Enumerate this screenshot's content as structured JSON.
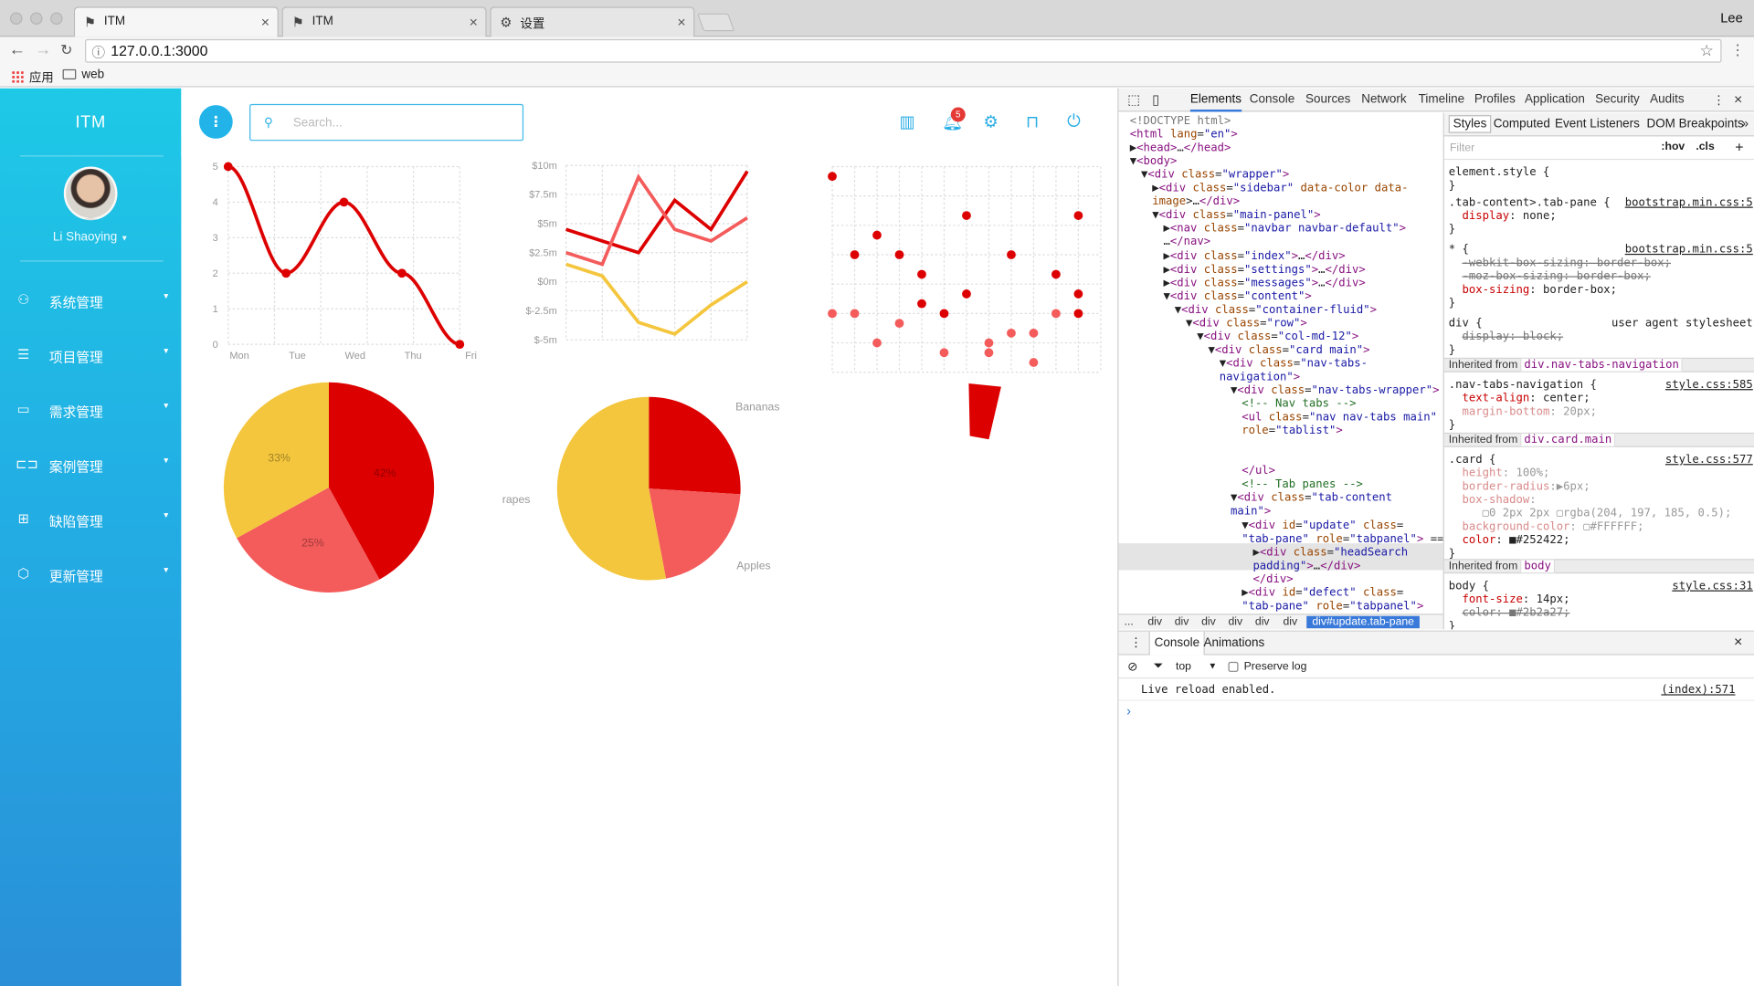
{
  "browser": {
    "tabs": [
      {
        "title": "ITM",
        "icon": "app-favicon"
      },
      {
        "title": "ITM",
        "icon": "app-favicon"
      },
      {
        "title": "设置",
        "icon": "gear-icon"
      }
    ],
    "user": "Lee",
    "url": "127.0.0.1:3000",
    "bookmarks": [
      {
        "label": "应用",
        "icon": "apps-icon"
      },
      {
        "label": "web",
        "icon": "folder-icon"
      }
    ]
  },
  "app": {
    "brand": "ITM",
    "user_name": "Li Shaoying",
    "search_placeholder": "Search...",
    "notification_count": "5",
    "menu": [
      {
        "label": "系统管理",
        "icon": "user-icon"
      },
      {
        "label": "项目管理",
        "icon": "database-icon"
      },
      {
        "label": "需求管理",
        "icon": "message-icon"
      },
      {
        "label": "案例管理",
        "icon": "book-icon"
      },
      {
        "label": "缺陷管理",
        "icon": "bug-icon"
      },
      {
        "label": "更新管理",
        "icon": "box-icon"
      }
    ],
    "header_icons": [
      "chart-icon",
      "bell-icon",
      "settings-icon",
      "lock-icon",
      "power-icon"
    ],
    "colors": {
      "primary": "#23b6e9",
      "red": "#dd0000",
      "light_red": "#f45b5b",
      "yellow": "#f4c63d"
    }
  },
  "chart_data": [
    {
      "type": "line",
      "categories": [
        "Mon",
        "Tue",
        "Wed",
        "Thu",
        "Fri"
      ],
      "series": [
        {
          "values": [
            5,
            2,
            4,
            2,
            0
          ]
        }
      ],
      "ylim": [
        0,
        5
      ],
      "yticks": [
        "0",
        "1",
        "2",
        "3",
        "4",
        "5"
      ]
    },
    {
      "type": "line",
      "yticks": [
        "$10m",
        "$7.5m",
        "$5m",
        "$2.5m",
        "$0m",
        "$-2.5m",
        "$-5m"
      ],
      "ylim": [
        -5,
        10
      ],
      "series": [
        {
          "values": [
            4.5,
            3.5,
            2.5,
            7,
            4.5,
            9.5
          ]
        },
        {
          "values": [
            2.5,
            1.5,
            9,
            4.5,
            3.5,
            5.5
          ]
        },
        {
          "values": [
            1.5,
            0.5,
            -3.5,
            -4.5,
            -2,
            0
          ]
        }
      ]
    },
    {
      "type": "scatter",
      "points": [
        {
          "x": 0,
          "y": 10
        },
        {
          "x": 1,
          "y": 6
        },
        {
          "x": 2,
          "y": 7
        },
        {
          "x": 3,
          "y": 6
        },
        {
          "x": 4,
          "y": 5
        },
        {
          "x": 4,
          "y": 3.5
        },
        {
          "x": 5,
          "y": 3
        },
        {
          "x": 6,
          "y": 8
        },
        {
          "x": 6,
          "y": 4
        },
        {
          "x": 8,
          "y": 6
        },
        {
          "x": 10,
          "y": 5
        },
        {
          "x": 11,
          "y": 3
        },
        {
          "x": 11,
          "y": 8
        },
        {
          "x": 11,
          "y": 4
        },
        {
          "x": 0,
          "y": 3
        },
        {
          "x": 1,
          "y": 3
        },
        {
          "x": 2,
          "y": 1.5
        },
        {
          "x": 3,
          "y": 2.5
        },
        {
          "x": 5,
          "y": 1
        },
        {
          "x": 7,
          "y": 1.5
        },
        {
          "x": 7,
          "y": 1
        },
        {
          "x": 8,
          "y": 2
        },
        {
          "x": 9,
          "y": 2
        },
        {
          "x": 9,
          "y": 0.5
        },
        {
          "x": 10,
          "y": 3
        }
      ],
      "xlim": [
        0,
        12
      ],
      "ylim": [
        0,
        10.5
      ]
    },
    {
      "type": "pie",
      "slices": [
        {
          "label": "42%",
          "value": 42
        },
        {
          "label": "25%",
          "value": 25
        },
        {
          "label": "33%",
          "value": 33
        }
      ]
    },
    {
      "type": "pie",
      "slices": [
        {
          "label": "Bananas",
          "value": 26
        },
        {
          "label": "Apples",
          "value": 21
        },
        {
          "label": "rapes",
          "value": 53
        }
      ]
    },
    {
      "type": "pie",
      "slices": [
        {
          "label": "",
          "value": 6
        }
      ]
    }
  ],
  "devtools": {
    "tabs": [
      "Elements",
      "Console",
      "Sources",
      "Network",
      "Timeline",
      "Profiles",
      "Application",
      "Security",
      "Audits"
    ],
    "dom": [
      {
        "i": 0,
        "html": "<span class='g'>&lt;!DOCTYPE html&gt;</span>"
      },
      {
        "i": 0,
        "html": "<span class='t'>&lt;html</span> <span class='a'>lang</span>=<span class='v'>\"en\"</span><span class='t'>&gt;</span>"
      },
      {
        "i": 0,
        "html": "▶<span class='t'>&lt;head&gt;</span>…<span class='t'>&lt;/head&gt;</span>"
      },
      {
        "i": 0,
        "html": "▼<span class='t'>&lt;body&gt;</span>"
      },
      {
        "i": 1,
        "html": "▼<span class='t'>&lt;div</span> <span class='a'>class</span>=<span class='v'>\"wrapper\"</span><span class='t'>&gt;</span>"
      },
      {
        "i": 2,
        "html": "▶<span class='t'>&lt;div</span> <span class='a'>class</span>=<span class='v'>\"sidebar\"</span> <span class='a'>data-color data-</span>"
      },
      {
        "i": 2,
        "html": "<span class='a'>image</span>&gt;…<span class='t'>&lt;/div&gt;</span>"
      },
      {
        "i": 2,
        "html": "▼<span class='t'>&lt;div</span> <span class='a'>class</span>=<span class='v'>\"main-panel\"</span><span class='t'>&gt;</span>"
      },
      {
        "i": 3,
        "html": "▶<span class='t'>&lt;nav</span> <span class='a'>class</span>=<span class='v'>\"navbar navbar-default\"</span><span class='t'>&gt;</span>"
      },
      {
        "i": 3,
        "html": "…<span class='t'>&lt;/nav&gt;</span>"
      },
      {
        "i": 3,
        "html": "▶<span class='t'>&lt;div</span> <span class='a'>class</span>=<span class='v'>\"index\"</span><span class='t'>&gt;</span>…<span class='t'>&lt;/div&gt;</span>"
      },
      {
        "i": 3,
        "html": "▶<span class='t'>&lt;div</span> <span class='a'>class</span>=<span class='v'>\"settings\"</span><span class='t'>&gt;</span>…<span class='t'>&lt;/div&gt;</span>"
      },
      {
        "i": 3,
        "html": "▶<span class='t'>&lt;div</span> <span class='a'>class</span>=<span class='v'>\"messages\"</span><span class='t'>&gt;</span>…<span class='t'>&lt;/div&gt;</span>"
      },
      {
        "i": 3,
        "html": "▼<span class='t'>&lt;div</span> <span class='a'>class</span>=<span class='v'>\"content\"</span><span class='t'>&gt;</span>"
      },
      {
        "i": 4,
        "html": "▼<span class='t'>&lt;div</span> <span class='a'>class</span>=<span class='v'>\"container-fluid\"</span><span class='t'>&gt;</span>"
      },
      {
        "i": 5,
        "html": "▼<span class='t'>&lt;div</span> <span class='a'>class</span>=<span class='v'>\"row\"</span><span class='t'>&gt;</span>"
      },
      {
        "i": 6,
        "html": "▼<span class='t'>&lt;div</span> <span class='a'>class</span>=<span class='v'>\"col-md-12\"</span><span class='t'>&gt;</span>"
      },
      {
        "i": 7,
        "html": "▼<span class='t'>&lt;div</span> <span class='a'>class</span>=<span class='v'>\"card main\"</span><span class='t'>&gt;</span>"
      },
      {
        "i": 8,
        "html": "▼<span class='t'>&lt;div</span> <span class='a'>class</span>=<span class='v'>\"nav-tabs-</span>"
      },
      {
        "i": 8,
        "html": "<span class='v'>navigation\"</span><span class='t'>&gt;</span>"
      },
      {
        "i": 9,
        "html": "▼<span class='t'>&lt;div</span> <span class='a'>class</span>=<span class='v'>\"nav-tabs-wrapper\"</span><span class='t'>&gt;</span>"
      },
      {
        "i": 10,
        "html": "<span class='c'>&lt;!-- Nav tabs --&gt;</span>"
      },
      {
        "i": 10,
        "html": "<span class='t'>&lt;ul</span> <span class='a'>class</span>=<span class='v'>\"nav nav-tabs main\"</span>"
      },
      {
        "i": 10,
        "html": "<span class='a'>role</span>=<span class='v'>\"tablist\"</span><span class='t'>&gt;</span>"
      },
      {
        "i": 10,
        "html": ""
      },
      {
        "i": 10,
        "html": ""
      },
      {
        "i": 10,
        "html": "<span class='t'>&lt;/ul&gt;</span>"
      },
      {
        "i": 10,
        "html": "<span class='c'>&lt;!-- Tab panes --&gt;</span>"
      },
      {
        "i": 9,
        "html": "▼<span class='t'>&lt;div</span> <span class='a'>class</span>=<span class='v'>\"tab-content</span>"
      },
      {
        "i": 9,
        "html": "<span class='v'>main\"</span><span class='t'>&gt;</span>"
      },
      {
        "i": 10,
        "html": "▼<span class='t'>&lt;div</span> <span class='a'>id</span>=<span class='v'>\"update\"</span> <span class='a'>class</span>="
      },
      {
        "i": 10,
        "html": "<span class='v'>\"tab-pane\"</span> <span class='a'>role</span>=<span class='v'>\"tabpanel\"</span><span class='t'>&gt;</span> =="
      },
      {
        "i": 11,
        "html": "▶<span class='t'>&lt;div</span> <span class='a'>class</span>=<span class='v'>\"headSearch</span>"
      },
      {
        "i": 11,
        "html": "<span class='v'>padding\"</span><span class='t'>&gt;</span>…<span class='t'>&lt;/div&gt;</span>"
      },
      {
        "i": 11,
        "html": "<span class='t'>&lt;/div&gt;</span>"
      },
      {
        "i": 10,
        "html": "▶<span class='t'>&lt;div</span> <span class='a'>id</span>=<span class='v'>\"defect\"</span> <span class='a'>class</span>="
      },
      {
        "i": 10,
        "html": "<span class='v'>\"tab-pane\"</span> <span class='a'>role</span>=<span class='v'>\"tabpanel\"</span><span class='t'>&gt;</span>"
      }
    ],
    "breadcrumbs": [
      "...",
      "div",
      "div",
      "div",
      "div",
      "div",
      "div",
      "div#update.tab-pane"
    ],
    "style_tabs": [
      "Styles",
      "Computed",
      "Event Listeners",
      "DOM Breakpoints"
    ],
    "filter_placeholder": "Filter",
    "filter_buttons": [
      ":hov",
      ".cls",
      "+"
    ],
    "styles": [
      {
        "y": 6,
        "html": "element.style {"
      },
      {
        "y": 18,
        "html": "}"
      },
      {
        "y": 33,
        "html": ".tab-content&gt;.tab-pane {",
        "src": "bootstrap.min.css:5"
      },
      {
        "y": 45,
        "html": "&nbsp;&nbsp;<span class='prop'>display</span>: none;"
      },
      {
        "y": 57,
        "html": "}"
      },
      {
        "y": 75,
        "html": "* {",
        "src": "bootstrap.min.css:5"
      },
      {
        "y": 87,
        "html": "&nbsp;&nbsp;<span class='strike'>-webkit-box-sizing: border-box;</span>"
      },
      {
        "y": 99,
        "html": "&nbsp;&nbsp;<span class='strike'>-moz-box-sizing: border-box;</span>"
      },
      {
        "y": 111,
        "html": "&nbsp;&nbsp;<span class='prop'>box-sizing</span>: border-box;"
      },
      {
        "y": 123,
        "html": "}"
      },
      {
        "y": 141,
        "html": "div {",
        "src": "user agent stylesheet",
        "plain": true
      },
      {
        "y": 153,
        "html": "&nbsp;&nbsp;<span class='strike'>display: block;</span>"
      },
      {
        "y": 165,
        "html": "}"
      },
      {
        "y": 196,
        "html": ".nav-tabs-navigation {",
        "src": "style.css:585"
      },
      {
        "y": 208,
        "html": "&nbsp;&nbsp;<span class='prop'>text-align</span>: center;"
      },
      {
        "y": 220,
        "html": "&nbsp;&nbsp;<span class='prop' style='color:#d98b8b'>margin-bottom</span><span style='color:#999'>: 20px;</span>"
      },
      {
        "y": 232,
        "html": "}"
      },
      {
        "y": 263,
        "html": ".card {",
        "src": "style.css:577"
      },
      {
        "y": 275,
        "html": "&nbsp;&nbsp;<span style='color:#d98b8b'>height</span><span style='color:#999'>: 100%;</span>"
      },
      {
        "y": 287,
        "html": "&nbsp;&nbsp;<span style='color:#d98b8b'>border-radius</span><span style='color:#999'>:▶6px;</span>"
      },
      {
        "y": 299,
        "html": "&nbsp;&nbsp;<span style='color:#d98b8b'>box-shadow</span><span style='color:#999'>:</span>"
      },
      {
        "y": 311,
        "html": "&nbsp;&nbsp;&nbsp;&nbsp;&nbsp;<span style='color:#999'>▢0 2px 2px ▢rgba(204, 197, 185, 0.5);</span>"
      },
      {
        "y": 323,
        "html": "&nbsp;&nbsp;<span style='color:#d98b8b'>background-color</span><span style='color:#999'>: ▢#FFFFFF;</span>"
      },
      {
        "y": 335,
        "html": "&nbsp;&nbsp;<span class='prop'>color</span>: ■#252422;"
      },
      {
        "y": 347,
        "html": "}"
      },
      {
        "y": 376,
        "html": "body {",
        "src": "style.css:31"
      },
      {
        "y": 388,
        "html": "&nbsp;&nbsp;<span class='prop'>font-size</span>: 14px;"
      },
      {
        "y": 400,
        "html": "&nbsp;&nbsp;<span class='strike'>color: ■#2b2a27;</span>"
      },
      {
        "y": 412,
        "html": "}"
      }
    ],
    "inherited": [
      {
        "y": 180,
        "label": "Inherited from",
        "sel": "div.nav-tabs-navigation"
      },
      {
        "y": 247,
        "label": "Inherited from",
        "sel": "div.card.main"
      },
      {
        "y": 360,
        "label": "Inherited from",
        "sel": "body"
      }
    ],
    "console": {
      "tabs": [
        "Console",
        "Animations"
      ],
      "context": "top",
      "preserve_log": "Preserve log",
      "message": "Live reload enabled.",
      "source": "(index):571"
    }
  }
}
